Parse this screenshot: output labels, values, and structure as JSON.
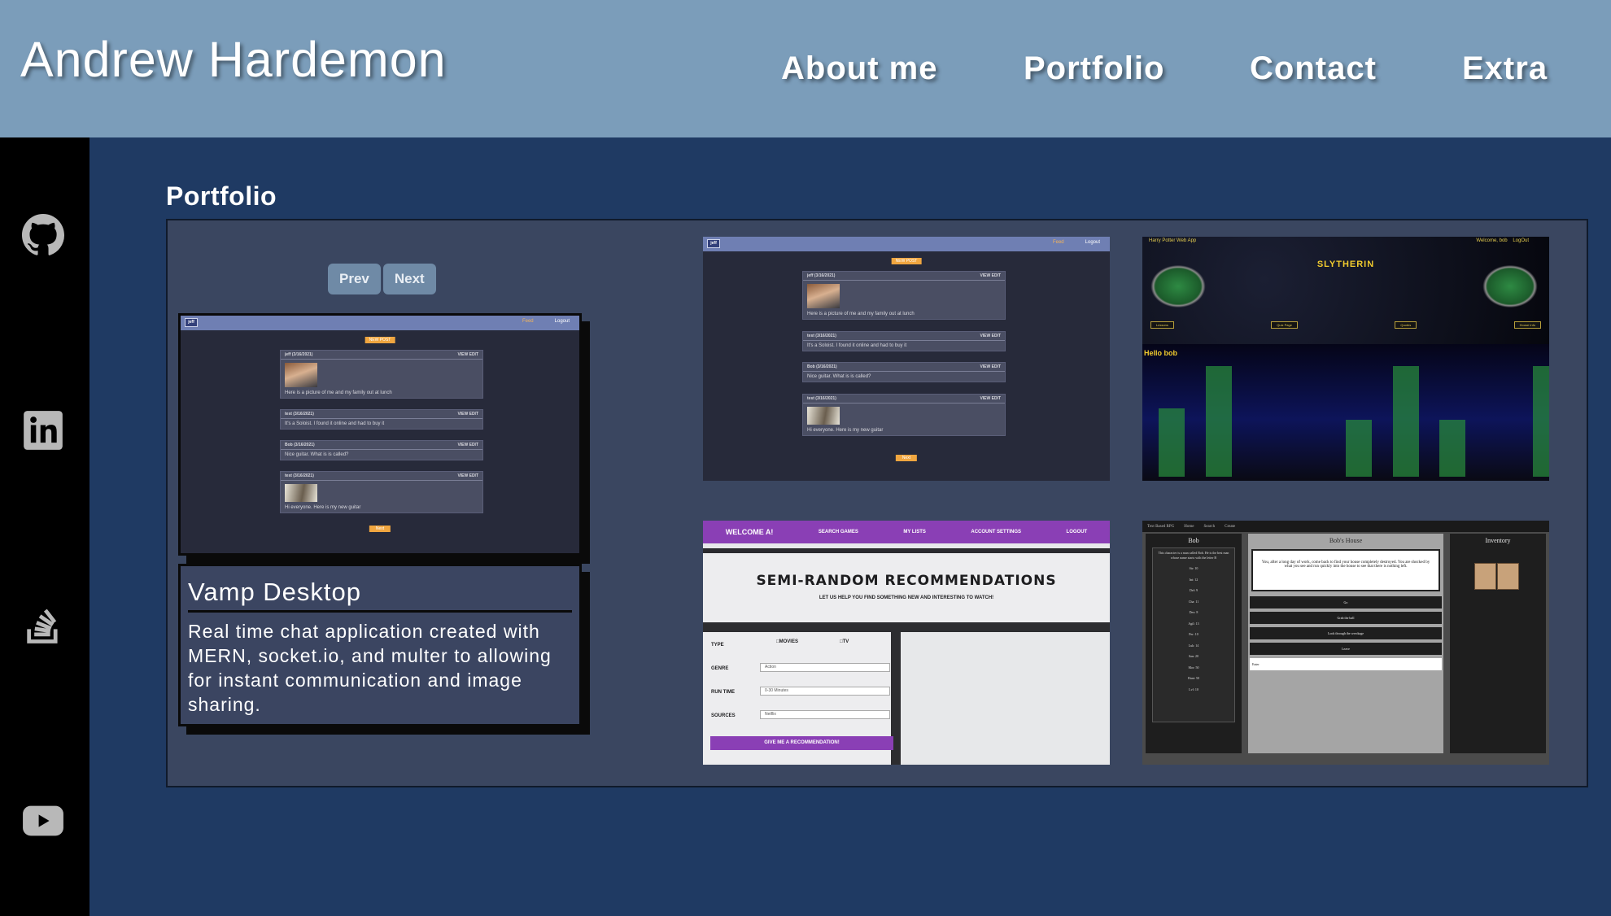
{
  "header": {
    "site_title": "Andrew Hardemon",
    "nav": [
      {
        "label": "About me"
      },
      {
        "label": "Portfolio"
      },
      {
        "label": "Contact"
      },
      {
        "label": "Extra"
      }
    ]
  },
  "sidebar": {
    "links": [
      {
        "icon": "github-icon"
      },
      {
        "icon": "linkedin-icon"
      },
      {
        "icon": "stack-overflow-icon"
      },
      {
        "icon": "youtube-icon"
      }
    ]
  },
  "colors": {
    "header_bg": "#7b9dba",
    "page_bg": "#1f3a63",
    "sidebar_bg": "#000000",
    "panel_bg": "#3a4660",
    "pager_button": "#6f8aa6"
  },
  "portfolio": {
    "section_title": "Portfolio",
    "pager": {
      "prev_label": "Prev",
      "next_label": "Next"
    },
    "featured": {
      "name": "Vamp Desktop",
      "description": "Real time chat application created with MERN, socket.io, and multer to allowing for instant communication and image sharing."
    },
    "vamp_mock": {
      "logo": "jeff",
      "nav_feed": "Feed",
      "nav_logout": "Logout",
      "new_post": "NEW POST",
      "view_edit": "VIEW EDIT",
      "next": "Next",
      "posts": [
        {
          "author": "jeff (3/16/2021)",
          "text": "Here is a picture of me and my family out at lunch"
        },
        {
          "author": "test (3/16/2021)",
          "text": "It's a Soloist. I found it online and had to buy it"
        },
        {
          "author": "Bob (3/16/2021)",
          "text": "Nice guitar. What is is called?"
        },
        {
          "author": "test (3/16/2021)",
          "text": "Hi everyone. Here is my new guitar"
        }
      ]
    },
    "hp_mock": {
      "app_title": "Harry Potter Web App",
      "welcome": "Welcome, bob",
      "logout": "LogOut",
      "house": "SLYTHERIN",
      "buttons": [
        "Lessons",
        "Quiz Page",
        "Quotes",
        "House Info"
      ],
      "greeting": "Hello bob",
      "bar_values": [
        0.6,
        0.97,
        0.0,
        0.0,
        0.5,
        0.97,
        0.5,
        0.0,
        0.97
      ]
    },
    "rec_mock": {
      "nav": [
        "WELCOME A!",
        "SEARCH GAMES",
        "MY LISTS",
        "ACCOUNT SETTINGS",
        "LOGOUT"
      ],
      "title": "SEMI-RANDOM RECOMMENDATIONS",
      "subtitle": "LET US HELP YOU FIND SOMETHING NEW AND INTERESTING TO WATCH!",
      "type_label": "TYPE",
      "type_movies": "MOVIES",
      "type_tv": "TV",
      "genre_label": "GENRE",
      "genre_value": "Action",
      "runtime_label": "RUN TIME",
      "runtime_value": "0-30 Minutes",
      "sources_label": "SOURCES",
      "sources_value": "Netflix",
      "go": "GIVE ME A RECOMMENDATION!"
    },
    "rpg_mock": {
      "app_title": "Text Based RPG",
      "tabs": [
        "Home",
        "Search",
        "Create"
      ],
      "char_name": "Bob",
      "char_desc": "This character is a man called Bob. He is the best man whose name starts with the letter B",
      "stats": [
        "Str: 10",
        "Int: 12",
        "Def: 9",
        "Cha: 11",
        "Dex: 8",
        "Agil: 13",
        "Per: 10",
        "Luk: 14",
        "San: 20",
        "Mor: 50",
        "Hunt: 50",
        "Lvl: 10"
      ],
      "location": "Bob's House",
      "story": "You, after a long day of work, come back to find your house completely destroyed. You are shocked by what you see and run quickly into the house to see that there is nothing left.",
      "choices": [
        "Go",
        "Grab the ball",
        "Look through the wreckage",
        "Leave"
      ],
      "input_label": "Enter",
      "inventory": "Inventory"
    }
  }
}
